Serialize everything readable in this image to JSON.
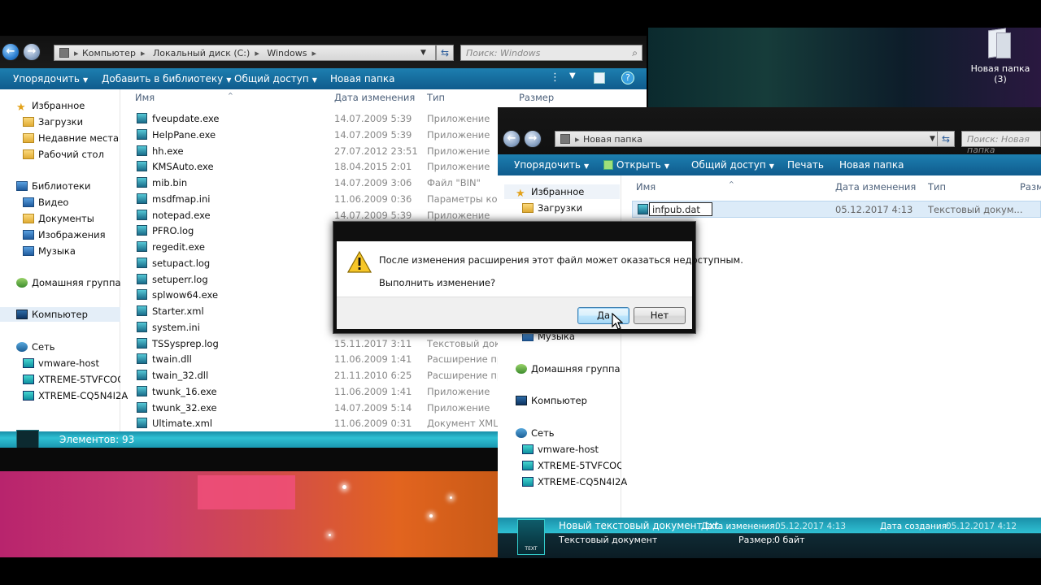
{
  "desktop": {
    "icon_label_1": "Новая папка",
    "icon_label_2": "(3)"
  },
  "win1": {
    "breadcrumb": [
      "Компьютер",
      "Локальный диск (C:)",
      "Windows"
    ],
    "search_placeholder": "Поиск: Windows",
    "toolbar": [
      "Упорядочить",
      "Добавить в библиотеку",
      "Общий доступ",
      "Новая папка"
    ],
    "nav": {
      "favorites": "Избранное",
      "fav_items": [
        "Загрузки",
        "Недавние места",
        "Рабочий стол"
      ],
      "libraries": "Библиотеки",
      "lib_items": [
        "Видео",
        "Документы",
        "Изображения",
        "Музыка"
      ],
      "homegroup": "Домашняя группа",
      "computer": "Компьютер",
      "network": "Сеть",
      "net_items": [
        "vmware-host",
        "XTREME-5TVFCOQC",
        "XTREME-CQ5N4I2A"
      ]
    },
    "columns": {
      "name": "Имя",
      "date": "Дата изменения",
      "type": "Тип",
      "size": "Размер"
    },
    "files": [
      {
        "name": "fveupdate.exe",
        "date": "14.07.2009 5:39",
        "type": "Приложение"
      },
      {
        "name": "HelpPane.exe",
        "date": "14.07.2009 5:39",
        "type": "Приложение"
      },
      {
        "name": "hh.exe",
        "date": "27.07.2012 23:51",
        "type": "Приложение"
      },
      {
        "name": "KMSAuto.exe",
        "date": "18.04.2015 2:01",
        "type": "Приложение"
      },
      {
        "name": "mib.bin",
        "date": "14.07.2009 3:06",
        "type": "Файл \"BIN\""
      },
      {
        "name": "msdfmap.ini",
        "date": "11.06.2009 0:36",
        "type": "Параметры конф"
      },
      {
        "name": "notepad.exe",
        "date": "14.07.2009 5:39",
        "type": "Приложение"
      },
      {
        "name": "PFRO.log",
        "date": "",
        "type": ""
      },
      {
        "name": "regedit.exe",
        "date": "",
        "type": ""
      },
      {
        "name": "setupact.log",
        "date": "",
        "type": ""
      },
      {
        "name": "setuperr.log",
        "date": "",
        "type": ""
      },
      {
        "name": "splwow64.exe",
        "date": "",
        "type": ""
      },
      {
        "name": "Starter.xml",
        "date": "",
        "type": ""
      },
      {
        "name": "system.ini",
        "date": "",
        "type": ""
      },
      {
        "name": "TSSysprep.log",
        "date": "15.11.2017 3:11",
        "type": "Текстовый докум"
      },
      {
        "name": "twain.dll",
        "date": "11.06.2009 1:41",
        "type": "Расширение при"
      },
      {
        "name": "twain_32.dll",
        "date": "21.11.2010 6:25",
        "type": "Расширение при"
      },
      {
        "name": "twunk_16.exe",
        "date": "11.06.2009 1:41",
        "type": "Приложение"
      },
      {
        "name": "twunk_32.exe",
        "date": "14.07.2009 5:14",
        "type": "Приложение"
      },
      {
        "name": "Ultimate.xml",
        "date": "11.06.2009 0:31",
        "type": "Документ XML"
      }
    ],
    "status": "Элементов: 93"
  },
  "win2": {
    "breadcrumb": [
      "Новая папка"
    ],
    "search_placeholder": "Поиск: Новая папка",
    "toolbar": [
      "Упорядочить",
      "Открыть",
      "Общий доступ",
      "Печать",
      "Новая папка"
    ],
    "nav": {
      "favorites": "Избранное",
      "fav_items": [
        "Загрузки"
      ],
      "music": "Музыка",
      "homegroup": "Домашняя группа",
      "computer": "Компьютер",
      "network": "Сеть",
      "net_items": [
        "vmware-host",
        "XTREME-5TVFCOQC",
        "XTREME-CQ5N4I2A"
      ]
    },
    "columns": {
      "name": "Имя",
      "date": "Дата изменения",
      "type": "Тип",
      "size": "Разм"
    },
    "file": {
      "name": "infpub.dat",
      "date": "05.12.2017 4:13",
      "type": "Текстовый докум..."
    },
    "details": {
      "filename": "Новый текстовый документ.txt",
      "modified_label": "Дата изменения:",
      "modified": "05.12.2017 4:13",
      "created_label": "Дата создания:",
      "created": "05.12.2017 4:12",
      "type": "Текстовый документ",
      "size_label": "Размер:",
      "size": "0 байт",
      "thumb_label": "TEXT"
    }
  },
  "dialog": {
    "message": "После изменения расширения этот файл может оказаться недоступным.",
    "question": "Выполнить изменение?",
    "yes": "Да",
    "no": "Нет"
  }
}
